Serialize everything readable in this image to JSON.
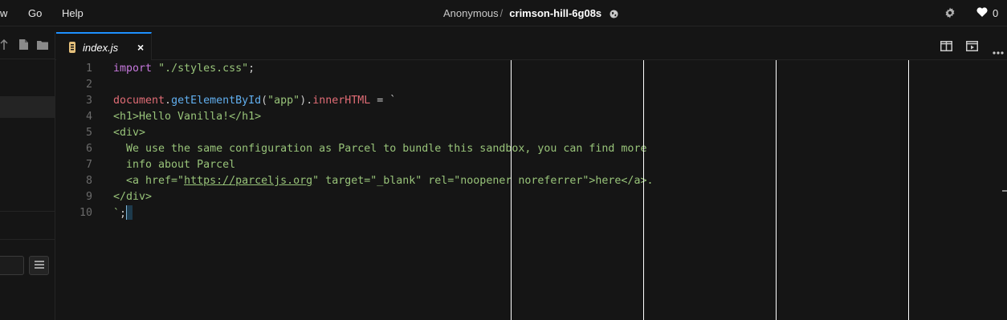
{
  "menu": {
    "items": [
      {
        "label": "w"
      },
      {
        "label": "Go"
      },
      {
        "label": "Help"
      }
    ]
  },
  "header": {
    "owner": "Anonymous",
    "separator": "/",
    "sandbox_name": "crimson-hill-6g08s",
    "likes": "0"
  },
  "tab": {
    "label": "index.js",
    "close": "×"
  },
  "editor": {
    "line_numbers": [
      "1",
      "2",
      "3",
      "4",
      "5",
      "6",
      "7",
      "8",
      "9",
      "10"
    ],
    "lines": [
      [
        {
          "t": "import",
          "c": "kw"
        },
        {
          "t": " ",
          "c": "plain"
        },
        {
          "t": "\"./styles.css\"",
          "c": "str"
        },
        {
          "t": ";",
          "c": "plain"
        }
      ],
      [],
      [
        {
          "t": "document",
          "c": "var"
        },
        {
          "t": ".",
          "c": "plain"
        },
        {
          "t": "getElementById",
          "c": "fn"
        },
        {
          "t": "(",
          "c": "plain"
        },
        {
          "t": "\"app\"",
          "c": "str"
        },
        {
          "t": ").",
          "c": "plain"
        },
        {
          "t": "innerHTML",
          "c": "var"
        },
        {
          "t": " = `",
          "c": "plain"
        }
      ],
      [
        {
          "t": "<h1>Hello Vanilla!</h1>",
          "c": "tpl"
        }
      ],
      [
        {
          "t": "<div>",
          "c": "tpl"
        }
      ],
      [
        {
          "t": "  We use the same configuration as Parcel to bundle this sandbox, you can find more",
          "c": "tpl"
        }
      ],
      [
        {
          "t": "  info about Parcel",
          "c": "tpl"
        }
      ],
      [
        {
          "t": "  <a href=\"",
          "c": "tpl"
        },
        {
          "t": "https://parceljs.org",
          "c": "url"
        },
        {
          "t": "\" target=\"_blank\" rel=\"noopener noreferrer\">here</a>.",
          "c": "tpl"
        }
      ],
      [
        {
          "t": "</div>",
          "c": "tpl"
        }
      ],
      [
        {
          "t": "`",
          "c": "tpl"
        },
        {
          "t": ";",
          "c": "plain"
        }
      ]
    ]
  },
  "colors": {
    "background": "#151515",
    "accent": "#1e90ff",
    "keyword": "#c678dd",
    "string": "#98c379",
    "variable": "#e06c75",
    "function": "#61afef"
  }
}
